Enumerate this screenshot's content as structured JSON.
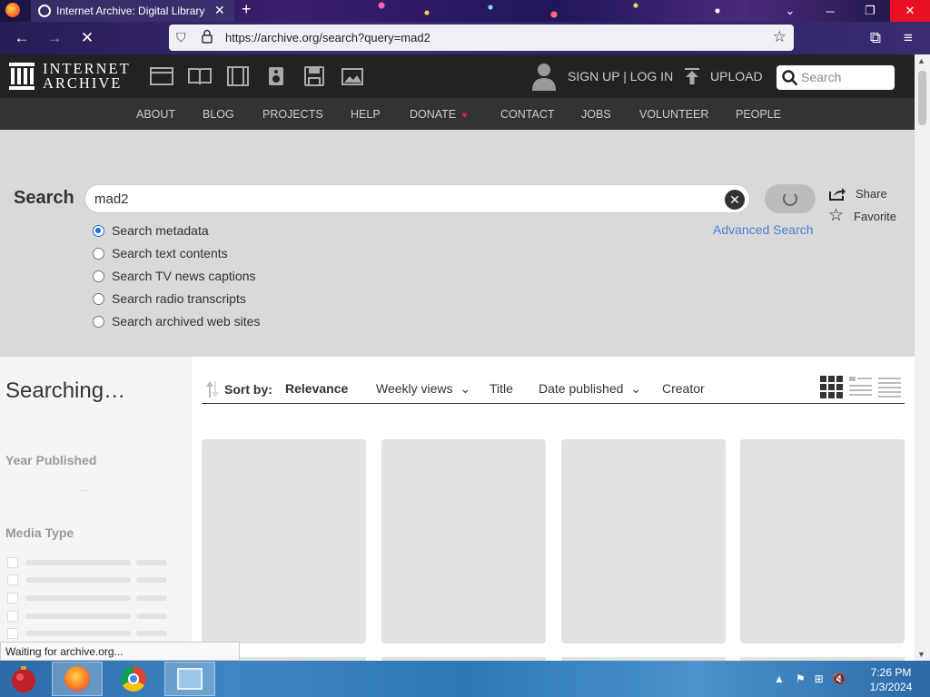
{
  "browser": {
    "tab_title": "Internet Archive: Digital Library",
    "url": "https://archive.org/search?query=mad2",
    "status_text": "Waiting for archive.org..."
  },
  "header": {
    "logo_line1": "INTERNET",
    "logo_line2": "ARCHIVE",
    "media_icons": [
      "web-icon",
      "texts-icon",
      "video-icon",
      "audio-icon",
      "software-icon",
      "images-icon"
    ],
    "signup_text": "SIGN UP | LOG IN",
    "upload_text": "UPLOAD",
    "search_placeholder": "Search"
  },
  "nav": {
    "items": [
      "ABOUT",
      "BLOG",
      "PROJECTS",
      "HELP",
      "DONATE",
      "CONTACT",
      "JOBS",
      "VOLUNTEER",
      "PEOPLE"
    ]
  },
  "search": {
    "label": "Search",
    "query": "mad2",
    "advanced_link": "Advanced Search",
    "share_label": "Share",
    "favorite_label": "Favorite",
    "options": [
      {
        "label": "Search metadata",
        "selected": true
      },
      {
        "label": "Search text contents",
        "selected": false
      },
      {
        "label": "Search TV news captions",
        "selected": false
      },
      {
        "label": "Search radio transcripts",
        "selected": false
      },
      {
        "label": "Search archived web sites",
        "selected": false
      }
    ]
  },
  "sidebar": {
    "status": "Searching…",
    "facet_year": "Year Published",
    "facet_year_loading": "...",
    "facet_media": "Media Type"
  },
  "results": {
    "sort_label": "Sort by:",
    "sort_options": [
      "Relevance",
      "Weekly views",
      "Title",
      "Date published",
      "Creator"
    ],
    "active_sort": "Relevance"
  },
  "taskbar": {
    "time": "7:26 PM",
    "date": "1/3/2024"
  },
  "colors": {
    "ia_dark": "#222222",
    "ia_nav": "#333333",
    "search_panel": "#d9d9d9",
    "link_blue": "#4a7fd3",
    "radio_blue": "#1a6fe0"
  }
}
